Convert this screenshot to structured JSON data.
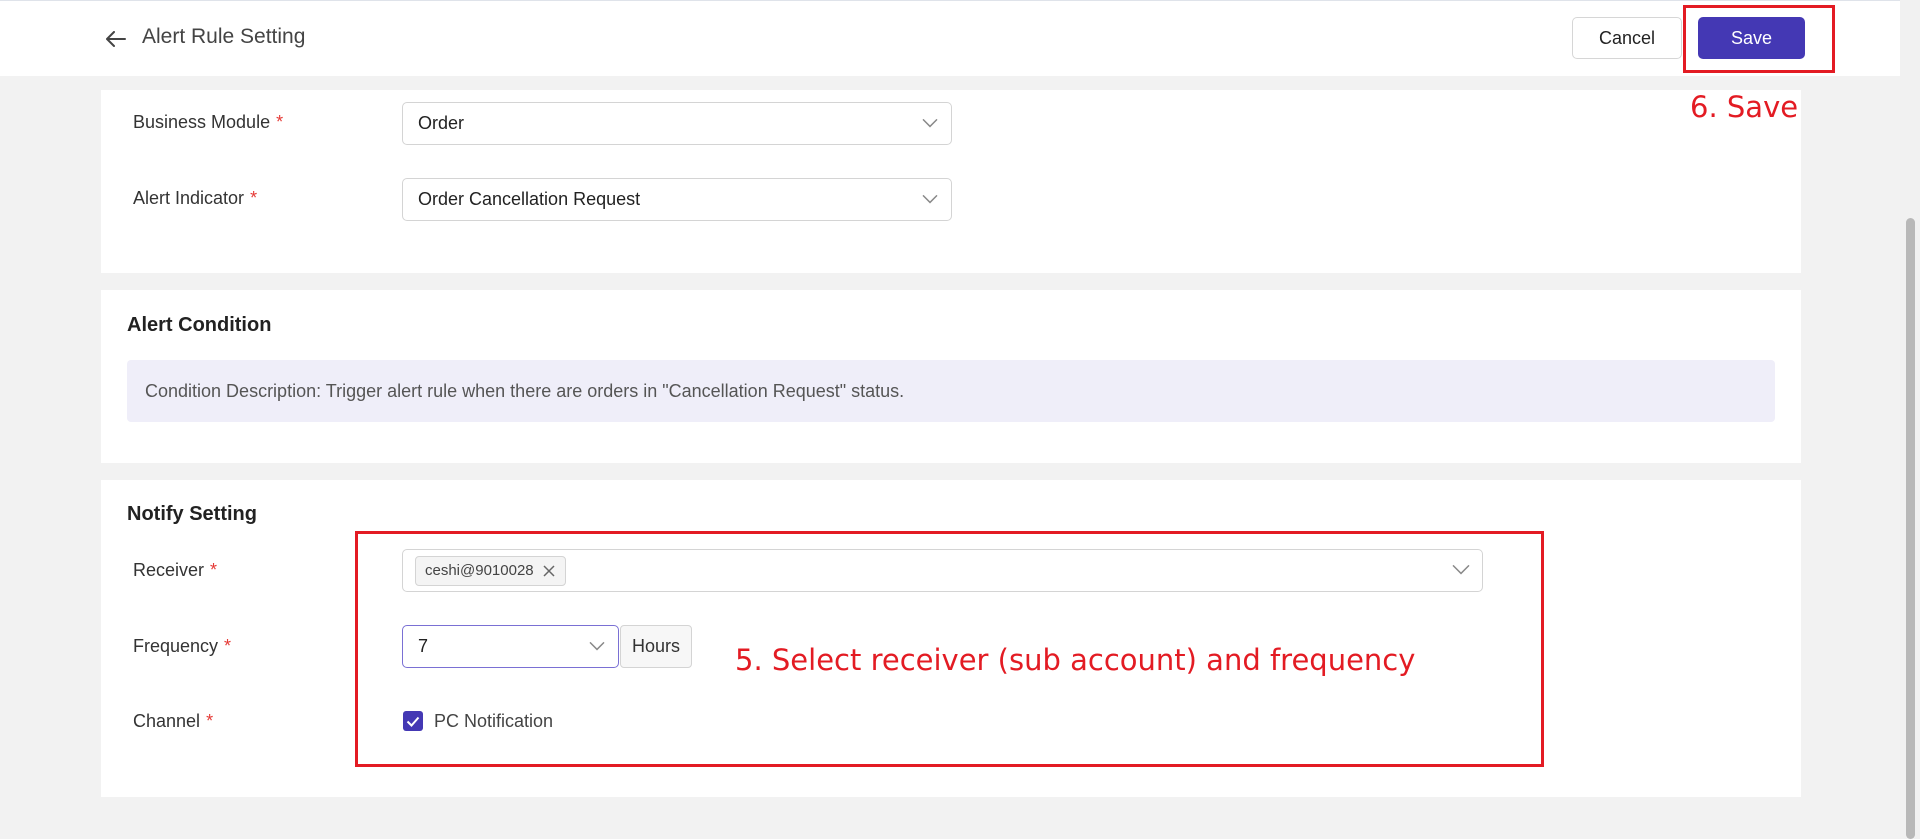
{
  "header": {
    "title": "Alert Rule Setting",
    "cancel_label": "Cancel",
    "save_label": "Save"
  },
  "basic": {
    "business_module_label": "Business Module",
    "business_module_value": "Order",
    "alert_indicator_label": "Alert Indicator",
    "alert_indicator_value": "Order Cancellation Request"
  },
  "condition": {
    "title": "Alert Condition",
    "description": "Condition Description: Trigger alert rule when there are orders in \"Cancellation Request\" status."
  },
  "notify": {
    "title": "Notify Setting",
    "receiver_label": "Receiver",
    "receiver_tags": [
      "ceshi@9010028"
    ],
    "frequency_label": "Frequency",
    "frequency_value": "7",
    "frequency_unit": "Hours",
    "channel_label": "Channel",
    "channel_option": "PC Notification",
    "channel_checked": true
  },
  "annotations": {
    "step5": "5. Select receiver (sub account) and frequency",
    "step6": "6. Save",
    "color": "#e31b23"
  },
  "colors": {
    "primary": "#4438b4",
    "required": "#e53935",
    "condition_bg": "#efeef9"
  },
  "icons": {
    "back": "arrow-left-icon",
    "dropdown": "chevron-down-icon",
    "tag_close": "close-icon",
    "check": "check-icon"
  }
}
